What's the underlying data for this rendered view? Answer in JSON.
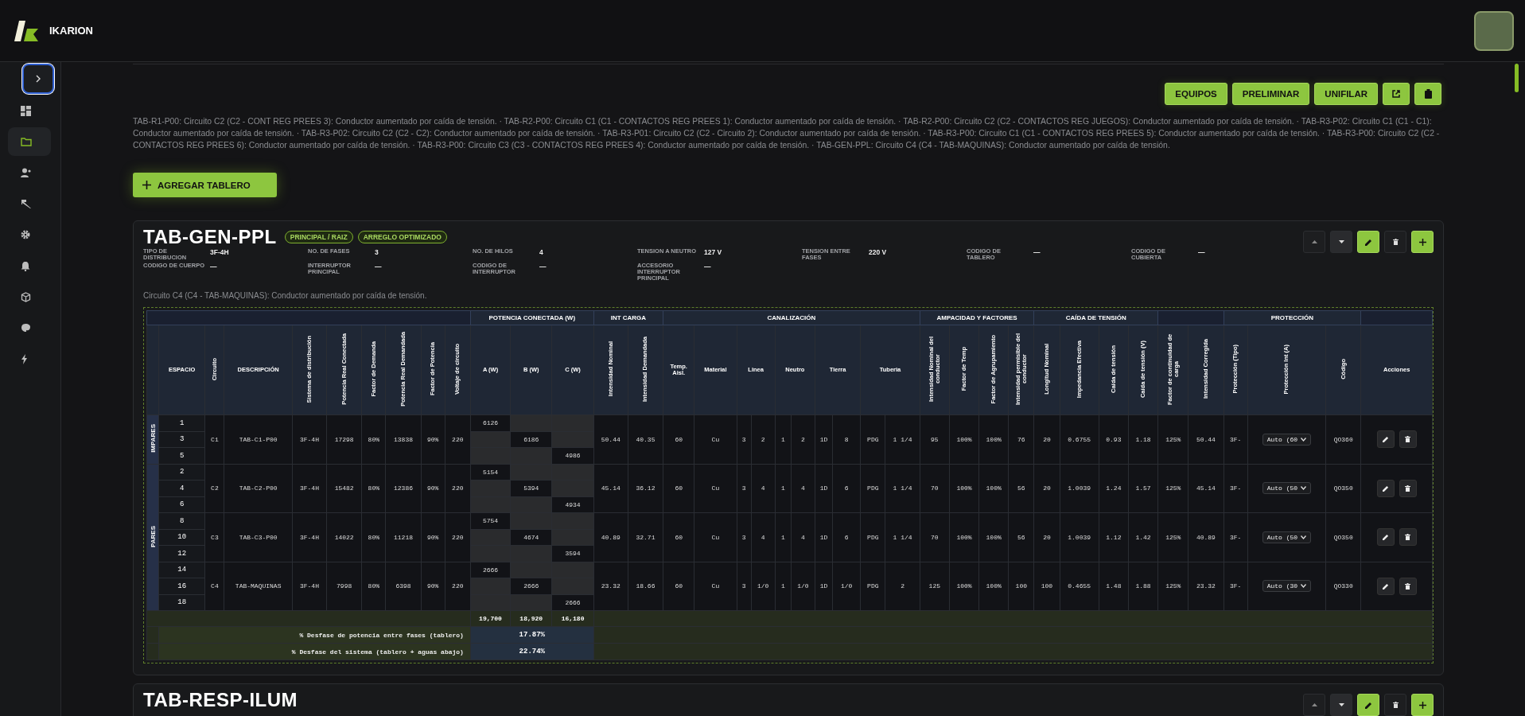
{
  "header": {
    "brand": "IKARION"
  },
  "sidebar": {
    "items": [
      {
        "selected": false
      },
      {
        "selected": true
      },
      {
        "selected": false
      },
      {
        "selected": false
      },
      {
        "selected": false
      },
      {
        "selected": false
      },
      {
        "selected": false
      },
      {
        "selected": false
      },
      {
        "selected": false
      }
    ]
  },
  "toolbar": {
    "buttons": [
      "EQUIPOS",
      "PRELIMINAR",
      "UNIFILAR"
    ]
  },
  "warnings": "TAB-R1-P00: Circuito C2 (C2 - CONT REG PREES 3): Conductor aumentado por caída de tensión. · TAB-R2-P00: Circuito C1 (C1 - CONTACTOS REG PREES 1): Conductor aumentado por caída de tensión. · TAB-R2-P00: Circuito C2 (C2 - CONTACTOS REG JUEGOS): Conductor aumentado por caída de tensión. · TAB-R3-P02: Circuito C1 (C1 - C1): Conductor aumentado por caída de tensión. · TAB-R3-P02: Circuito C2 (C2 - C2): Conductor aumentado por caída de tensión. · TAB-R3-P01: Circuito C2 (C2 - Circuito 2): Conductor aumentado por caída de tensión. · TAB-R3-P00: Circuito C1 (C1 - CONTACTOS REG PREES 5): Conductor aumentado por caída de tensión. · TAB-R3-P00: Circuito C2 (C2 - CONTACTOS REG PREES 6): Conductor aumentado por caída de tensión. · TAB-R3-P00: Circuito C3 (C3 - CONTACTOS REG PREES 4): Conductor aumentado por caída de tensión. · TAB-GEN-PPL: Circuito C4 (C4 - TAB-MAQUINAS): Conductor aumentado por caída de tensión.",
  "add_button": "AGREGAR TABLERO",
  "boards": [
    {
      "title": "TAB-GEN-PPL",
      "badges": [
        "PRINCIPAL / RAIZ",
        "ARREGLO OPTIMIZADO"
      ],
      "fields": [
        {
          "label": "TIPO DE DISTRIBUCION",
          "value": "3F-4H"
        },
        {
          "label": "NO. DE FASES",
          "value": "3"
        },
        {
          "label": "NO. DE HILOS",
          "value": "4"
        },
        {
          "label": "TENSION A NEUTRO",
          "value": "127 V"
        },
        {
          "label": "TENSION ENTRE FASES",
          "value": "220 V"
        },
        {
          "label": "CODIGO DE TABLERO",
          "value": "—"
        },
        {
          "label": "CODIGO DE CUBIERTA",
          "value": "—"
        },
        {
          "label": "CODIGO DE CUERPO",
          "value": "—"
        },
        {
          "label": "INTERRUPTOR PRINCIPAL",
          "value": "—"
        },
        {
          "label": "CODIGO DE INTERRUPTOR",
          "value": "—"
        },
        {
          "label": "ACCESORIO INTERRUPTOR PRINCIPAL",
          "value": "—"
        }
      ],
      "note": "Circuito C4 (C4 - TAB-MAQUINAS): Conductor aumentado por caída de tensión.",
      "table": {
        "groups": [
          {
            "columns": [
              {
                "label": "ESPACIO",
                "kind": "flat"
              },
              {
                "label": "Circuito",
                "kind": "vertical"
              },
              {
                "label": "DESCRIPCIÓN",
                "kind": "flat"
              },
              {
                "label": "Sistema de distribución",
                "kind": "vertical"
              },
              {
                "label": "Potencia Real Conectada",
                "kind": "vertical"
              },
              {
                "label": "Factor de Demanda",
                "kind": "vertical"
              },
              {
                "label": "Potencia Real Demandada",
                "kind": "vertical"
              },
              {
                "label": "Factor de Potencia",
                "kind": "vertical"
              },
              {
                "label": "Voltaje de circuito",
                "kind": "vertical"
              }
            ]
          },
          {
            "label": "POTENCIA CONECTADA (W)",
            "columns": [
              {
                "label": "A (W)",
                "kind": "flat"
              },
              {
                "label": "B (W)",
                "kind": "flat"
              },
              {
                "label": "C (W)",
                "kind": "flat"
              }
            ]
          },
          {
            "label": "INT CARGA",
            "columns": [
              {
                "label": "Intensidad Nominal",
                "kind": "vertical"
              },
              {
                "label": "Intensidad Demandada",
                "kind": "vertical"
              }
            ]
          },
          {
            "label": "CANALIZACIÓN",
            "columns": [
              {
                "label": "Temp. Aisl.",
                "kind": "flat"
              },
              {
                "label": "Material",
                "kind": "flat"
              },
              {
                "label": "Linea",
                "kind": "pair"
              },
              {
                "label": "Neutro",
                "kind": "pair"
              },
              {
                "label": "Tierra",
                "kind": "pair"
              },
              {
                "label": "Tuberia",
                "kind": "pair"
              }
            ]
          },
          {
            "label": "AMPACIDAD Y FACTORES",
            "columns": [
              {
                "label": "Intensidad Nominal del conductor",
                "kind": "vertical"
              },
              {
                "label": "Factor de Temp",
                "kind": "vertical"
              },
              {
                "label": "Factor de Agrupamiento",
                "kind": "vertical"
              },
              {
                "label": "Intensidad permisible del conductor",
                "kind": "vertical"
              }
            ]
          },
          {
            "label": "CAÍDA DE TENSIÓN",
            "columns": [
              {
                "label": "Longitud Nominal",
                "kind": "vertical"
              },
              {
                "label": "Impedancia Efectiva",
                "kind": "vertical"
              },
              {
                "label": "Caída de tensión",
                "kind": "vertical"
              },
              {
                "label": "Caída de tensión (V)",
                "kind": "vertical"
              }
            ]
          },
          {
            "columns": [
              {
                "label": "Factor de continuidad de carga",
                "kind": "vertical"
              },
              {
                "label": "Intensidad Corregida",
                "kind": "vertical"
              }
            ]
          },
          {
            "label": "PROTECCIÓN",
            "columns": [
              {
                "label": "Protección (Tipo)",
                "kind": "vertical"
              },
              {
                "label": "Protección Int (A)",
                "kind": "vertical"
              },
              {
                "label": "Código",
                "kind": "vertical"
              }
            ]
          },
          {
            "columns": [
              {
                "label": "Acciones",
                "kind": "flat"
              }
            ]
          }
        ],
        "sides": [
          {
            "label": "IMPARES",
            "circuits": [
              {
                "spaces": [
                  "1",
                  "3",
                  "5"
                ],
                "values": [
                  "C1",
                  "TAB-C1-P00",
                  "3F-4H",
                  "17298",
                  "80%",
                  "13838",
                  "90%",
                  "220"
                ],
                "loads": [
                  "6126",
                  "6186",
                  "4986"
                ],
                "results": [
                  "50.44",
                  "40.35",
                  "60",
                  "Cu",
                  "3",
                  "2",
                  "1",
                  "2",
                  "1D",
                  "8",
                  "PDG",
                  "1 1/4",
                  "95",
                  "100%",
                  "100%",
                  "76",
                  "20",
                  "0.6755",
                  "0.93",
                  "1.18",
                  "125%",
                  "50.44",
                  "3F-"
                ],
                "breaker": "Auto (60",
                "code": "QO360"
              }
            ]
          },
          {
            "label": "PARES",
            "circuits": [
              {
                "spaces": [
                  "2",
                  "4",
                  "6"
                ],
                "values": [
                  "C2",
                  "TAB-C2-P00",
                  "3F-4H",
                  "15482",
                  "80%",
                  "12386",
                  "90%",
                  "220"
                ],
                "loads": [
                  "5154",
                  "5394",
                  "4934"
                ],
                "results": [
                  "45.14",
                  "36.12",
                  "60",
                  "Cu",
                  "3",
                  "4",
                  "1",
                  "4",
                  "1D",
                  "6",
                  "PDG",
                  "1 1/4",
                  "70",
                  "100%",
                  "100%",
                  "56",
                  "20",
                  "1.0039",
                  "1.24",
                  "1.57",
                  "125%",
                  "45.14",
                  "3F-"
                ],
                "breaker": "Auto (50",
                "code": "QO350"
              },
              {
                "spaces": [
                  "8",
                  "10",
                  "12"
                ],
                "values": [
                  "C3",
                  "TAB-C3-P00",
                  "3F-4H",
                  "14022",
                  "80%",
                  "11218",
                  "90%",
                  "220"
                ],
                "loads": [
                  "5754",
                  "4674",
                  "3594"
                ],
                "results": [
                  "40.89",
                  "32.71",
                  "60",
                  "Cu",
                  "3",
                  "4",
                  "1",
                  "4",
                  "1D",
                  "6",
                  "PDG",
                  "1 1/4",
                  "70",
                  "100%",
                  "100%",
                  "56",
                  "20",
                  "1.0039",
                  "1.12",
                  "1.42",
                  "125%",
                  "40.89",
                  "3F-"
                ],
                "breaker": "Auto (50",
                "code": "QO350"
              },
              {
                "spaces": [
                  "14",
                  "16",
                  "18"
                ],
                "values": [
                  "C4",
                  "TAB-MAQUINAS",
                  "3F-4H",
                  "7998",
                  "80%",
                  "6398",
                  "90%",
                  "220"
                ],
                "loads": [
                  "2666",
                  "2666",
                  "2666"
                ],
                "results": [
                  "23.32",
                  "18.66",
                  "60",
                  "Cu",
                  "3",
                  "1/0",
                  "1",
                  "1/0",
                  "1D",
                  "1/0",
                  "PDG",
                  "2",
                  "125",
                  "100%",
                  "100%",
                  "100",
                  "100",
                  "0.4655",
                  "1.48",
                  "1.88",
                  "125%",
                  "23.32",
                  "3F-"
                ],
                "breaker": "Auto (30",
                "code": "QO330"
              }
            ]
          }
        ],
        "totals": [
          "19,700",
          "18,920",
          "16,180"
        ],
        "summary": [
          {
            "label": "% Desfase de potencia entre fases (tablero)",
            "value": "17.87%"
          },
          {
            "label": "% Desfase del sistema (tablero + aguas abajo)",
            "value": "22.74%"
          }
        ]
      }
    },
    {
      "title": "TAB-RESP-ILUM"
    }
  ]
}
